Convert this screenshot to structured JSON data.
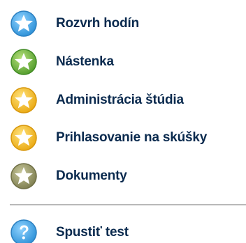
{
  "menu": {
    "items": [
      {
        "label": "Rozvrh hodín",
        "icon": "star-icon",
        "color": "#3aa3e6"
      },
      {
        "label": "Nástenka",
        "icon": "star-icon",
        "color": "#6ab23c"
      },
      {
        "label": "Administrácia štúdia",
        "icon": "star-icon",
        "color": "#f2b81c"
      },
      {
        "label": "Prihlasovanie na skúšky",
        "icon": "star-icon",
        "color": "#f2b81c"
      },
      {
        "label": "Dokumenty",
        "icon": "star-icon",
        "color": "#8c8c5c"
      }
    ],
    "test": {
      "label": "Spustiť test",
      "icon": "question-icon",
      "color": "#3aa3e6"
    }
  }
}
